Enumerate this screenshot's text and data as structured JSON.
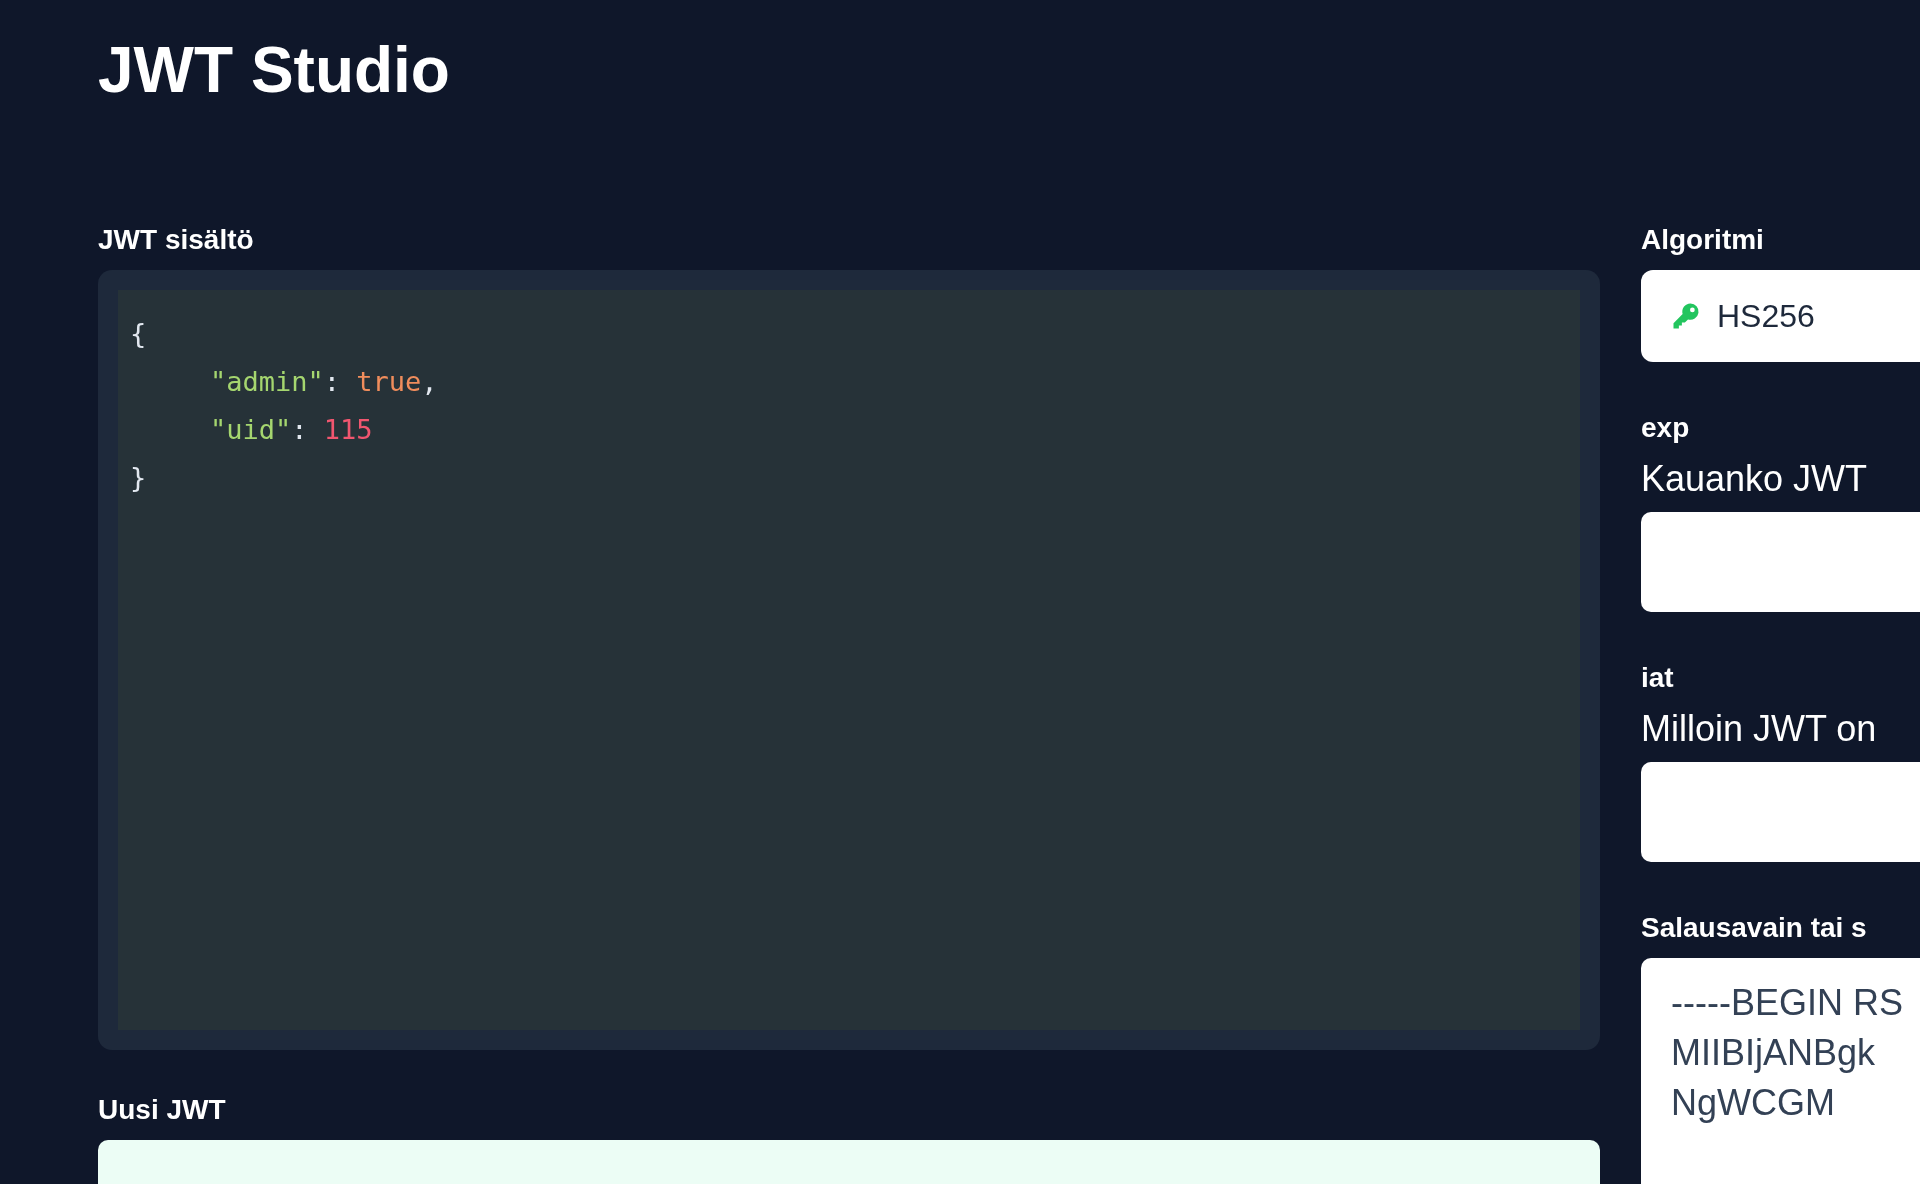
{
  "title": "JWT Studio",
  "editor": {
    "label": "JWT sisältö",
    "open": "{",
    "close": "}",
    "entries": [
      {
        "key": "\"admin\"",
        "colon": ":",
        "value": "true",
        "kind": "bool",
        "comma": ","
      },
      {
        "key": "\"uid\"",
        "colon": ":",
        "value": "115",
        "kind": "number"
      }
    ]
  },
  "output": {
    "label": "Uusi JWT"
  },
  "algorithm": {
    "label": "Algoritmi",
    "value": "HS256"
  },
  "claims": [
    {
      "label": "exp",
      "description": "Kauanko JWT"
    },
    {
      "label": "iat",
      "description": "Milloin JWT on"
    }
  ],
  "secret": {
    "label": "Salausavain tai s",
    "lines": [
      "-----BEGIN RS",
      "MIIBIjANBgk",
      "NgWCGM"
    ]
  }
}
